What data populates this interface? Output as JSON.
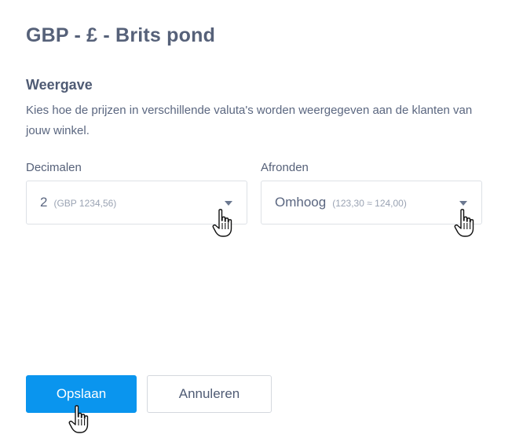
{
  "header": {
    "title": "GBP - £ - Brits pond"
  },
  "display": {
    "heading": "Weergave",
    "description": "Kies hoe de prijzen in verschillende valuta's worden weergegeven aan de klanten van jouw winkel."
  },
  "decimals": {
    "label": "Decimalen",
    "value": "2",
    "hint": "(GBP 1234,56)"
  },
  "rounding": {
    "label": "Afronden",
    "value": "Omhoog",
    "hint": "(123,30 ≈ 124,00)"
  },
  "actions": {
    "save_label": "Opslaan",
    "cancel_label": "Annuleren"
  },
  "colors": {
    "primary": "#0a95ee",
    "text": "#566179"
  },
  "icons": [
    "chevron-down-icon",
    "hand-pointer-icon"
  ]
}
